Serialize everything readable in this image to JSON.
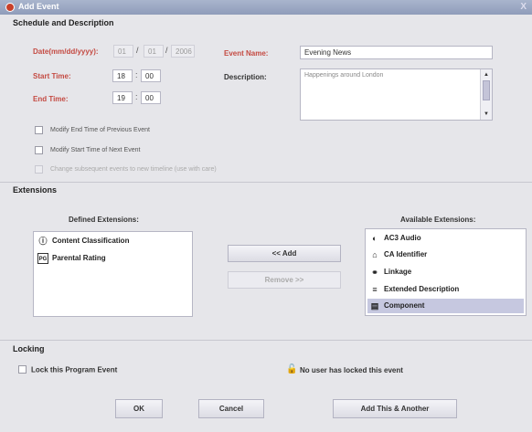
{
  "window": {
    "title": "Add Event",
    "close": "X"
  },
  "schedule": {
    "section_title": "Schedule and Description",
    "date_label": "Date(mm/dd/yyyy):",
    "date_month": "01",
    "date_day": "01",
    "date_year": "2006",
    "start_label": "Start Time:",
    "start_hour": "18",
    "start_min": "00",
    "end_label": "End Time:",
    "end_hour": "19",
    "end_min": "00",
    "event_name_label": "Event Name:",
    "event_name_value": "Evening News",
    "description_label": "Description:",
    "description_value": "Happenings around London",
    "checkboxes": [
      {
        "label": "Modify End Time of Previous Event",
        "enabled": true
      },
      {
        "label": "Modify Start Time of Next Event",
        "enabled": true
      },
      {
        "label": "Change subsequent events to new timeline (use with care)",
        "enabled": false
      }
    ]
  },
  "extensions": {
    "section_title": "Extensions",
    "defined_title": "Defined Extensions:",
    "defined_items": [
      {
        "icon": "info-icon",
        "glyph": "ⓘ",
        "label": "Content Classification"
      },
      {
        "icon": "pg-rating-icon",
        "glyph": "PG",
        "label": "Parental Rating"
      }
    ],
    "add_button": "<< Add",
    "remove_button": "Remove >>",
    "available_title": "Available Extensions:",
    "available_items": [
      {
        "icon": "audio-icon",
        "glyph": "◐",
        "label": "AC3 Audio"
      },
      {
        "icon": "ca-lock-icon",
        "glyph": "⌂",
        "label": "CA Identifier"
      },
      {
        "icon": "link-icon",
        "glyph": "⚭",
        "label": "Linkage"
      },
      {
        "icon": "document-icon",
        "glyph": "≡",
        "label": "Extended Description"
      },
      {
        "icon": "component-icon",
        "glyph": "▤",
        "label": "Component"
      }
    ],
    "selected_available_index": 4
  },
  "locking": {
    "section_title": "Locking",
    "checkbox_label": "Lock this Program Event",
    "status": "No user has locked this event"
  },
  "footer": {
    "ok": "OK",
    "cancel": "Cancel",
    "add_another": "Add This & Another"
  },
  "colors": {
    "required_label": "#c44a42",
    "selection": "#c6c8e0",
    "title_bar": "#94a0bd"
  }
}
